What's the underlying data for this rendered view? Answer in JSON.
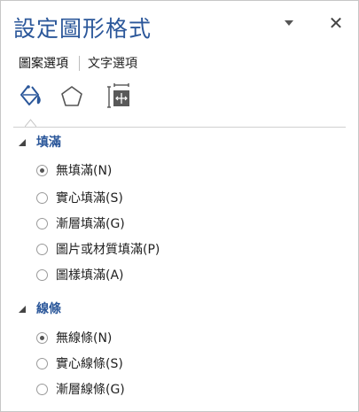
{
  "pane": {
    "title": "設定圖形格式",
    "dropdown_icon": "chevron-down-icon",
    "close_glyph": "✕"
  },
  "tabs": [
    {
      "label": "圖案選項",
      "active": true
    },
    {
      "label": "文字選項",
      "active": false
    }
  ],
  "icon_tabs": [
    {
      "name": "fill-line-icon",
      "selected": true
    },
    {
      "name": "effects-pentagon-icon",
      "selected": false
    },
    {
      "name": "size-properties-icon",
      "selected": false
    }
  ],
  "fill": {
    "header": "填滿",
    "options": [
      {
        "label": "無填滿(N)",
        "checked": true
      },
      {
        "label": "實心填滿(S)",
        "checked": false
      },
      {
        "label": "漸層填滿(G)",
        "checked": false
      },
      {
        "label": "圖片或材質填滿(P)",
        "checked": false
      },
      {
        "label": "圖樣填滿(A)",
        "checked": false
      }
    ]
  },
  "line": {
    "header": "線條",
    "options": [
      {
        "label": "無線條(N)",
        "checked": true
      },
      {
        "label": "實心線條(S)",
        "checked": false
      },
      {
        "label": "漸層線條(G)",
        "checked": false
      }
    ]
  },
  "colors": {
    "accent": "#2b579a",
    "icon_blue": "#2b579a"
  }
}
